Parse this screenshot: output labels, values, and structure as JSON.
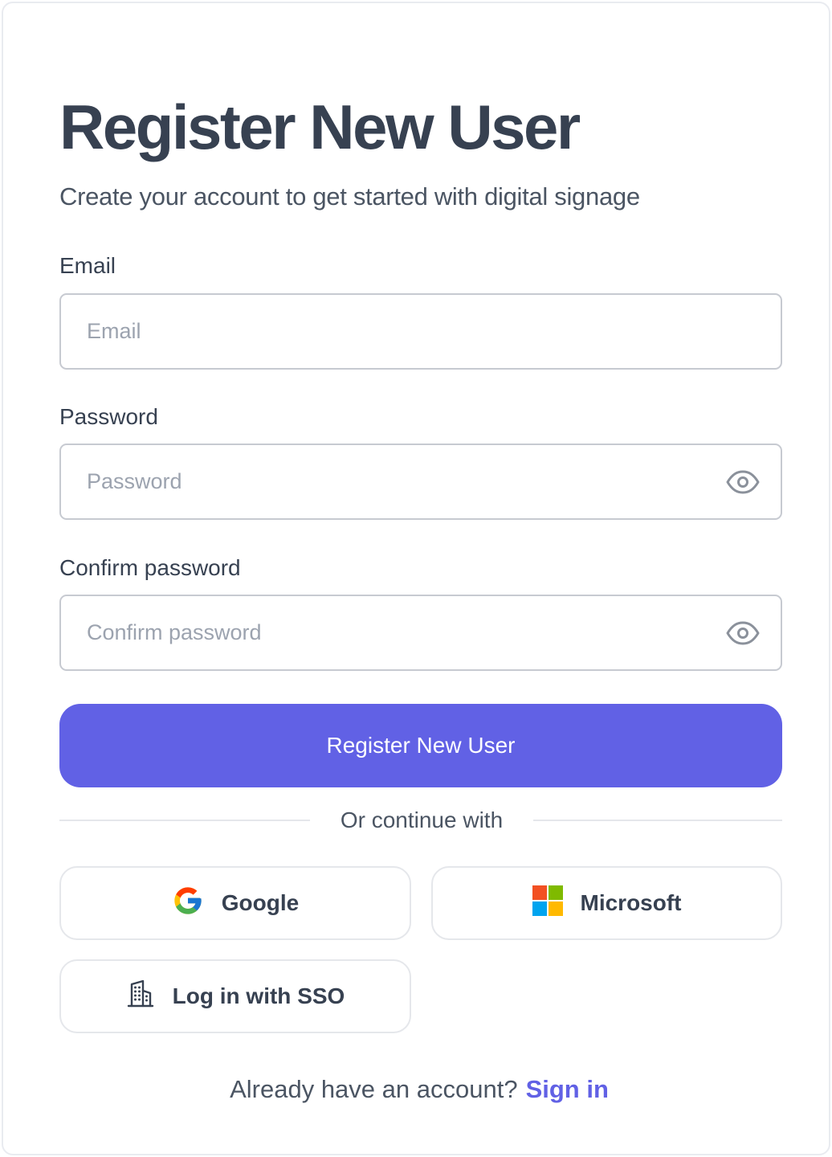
{
  "header": {
    "title": "Register New User",
    "subtitle": "Create your account to get started with digital signage"
  },
  "form": {
    "email": {
      "label": "Email",
      "placeholder": "Email",
      "value": ""
    },
    "password": {
      "label": "Password",
      "placeholder": "Password",
      "value": "",
      "icon": "eye-icon"
    },
    "confirm": {
      "label": "Confirm password",
      "placeholder": "Confirm password",
      "value": "",
      "icon": "eye-icon"
    },
    "submit_label": "Register New User"
  },
  "divider": {
    "text": "Or continue with"
  },
  "social": {
    "google": {
      "label": "Google",
      "icon": "google-logo-icon"
    },
    "microsoft": {
      "label": "Microsoft",
      "icon": "microsoft-logo-icon"
    },
    "sso": {
      "label": "Log in with SSO",
      "icon": "building-icon"
    }
  },
  "footer": {
    "prompt": "Already have an account?",
    "link": "Sign in"
  },
  "colors": {
    "accent": "#6161e5",
    "title": "#374151",
    "text_muted": "#4b5563",
    "placeholder": "#9ca3af",
    "border": "#c7cad1"
  }
}
